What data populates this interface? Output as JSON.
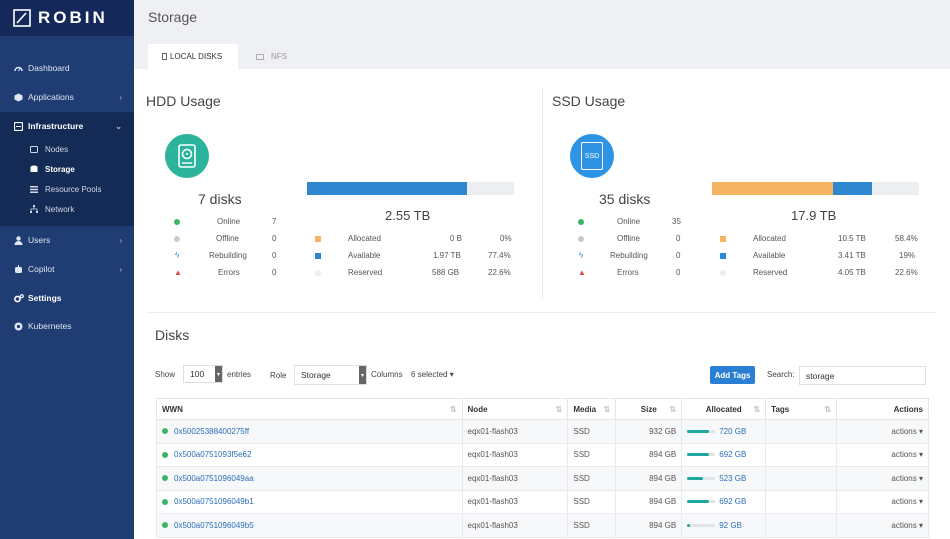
{
  "app": {
    "brand": "ROBIN"
  },
  "sidebar": {
    "items": [
      {
        "label": "Dashboard"
      },
      {
        "label": "Applications"
      },
      {
        "label": "Infrastructure"
      },
      {
        "label": "Users"
      },
      {
        "label": "Copilot"
      },
      {
        "label": "Settings"
      },
      {
        "label": "Kubernetes"
      }
    ],
    "infrastructure_sub": [
      {
        "label": "Nodes"
      },
      {
        "label": "Storage"
      },
      {
        "label": "Resource Pools"
      },
      {
        "label": "Network"
      }
    ]
  },
  "page": {
    "title": "Storage"
  },
  "tabs": [
    {
      "label": "LOCAL DISKS"
    },
    {
      "label": "NFS"
    }
  ],
  "hdd": {
    "title": "HDD Usage",
    "disks": "7 disks",
    "total": "2.55 TB",
    "status": [
      {
        "label": "Online",
        "value": "7"
      },
      {
        "label": "Offline",
        "value": "0"
      },
      {
        "label": "Rebuilding",
        "value": "0"
      },
      {
        "label": "Errors",
        "value": "0"
      }
    ],
    "usage": [
      {
        "label": "Allocated",
        "size": "0 B",
        "pct": "0%"
      },
      {
        "label": "Available",
        "size": "1.97 TB",
        "pct": "77.4%"
      },
      {
        "label": "Reserved",
        "size": "588 GB",
        "pct": "22.6%"
      }
    ],
    "bar": {
      "allocated": 0.0,
      "available": 77.4,
      "reserved": 22.6
    }
  },
  "ssd": {
    "title": "SSD Usage",
    "icon_text": "SSD",
    "disks": "35 disks",
    "total": "17.9 TB",
    "status": [
      {
        "label": "Online",
        "value": "35"
      },
      {
        "label": "Offline",
        "value": "0"
      },
      {
        "label": "Rebuilding",
        "value": "0"
      },
      {
        "label": "Errors",
        "value": "0"
      }
    ],
    "usage": [
      {
        "label": "Allocated",
        "size": "10.5 TB",
        "pct": "58.4%"
      },
      {
        "label": "Available",
        "size": "3.41 TB",
        "pct": "19%"
      },
      {
        "label": "Reserved",
        "size": "4.05 TB",
        "pct": "22.6%"
      }
    ],
    "bar": {
      "allocated": 58.4,
      "available": 19.0,
      "reserved": 22.6
    }
  },
  "disks": {
    "title": "Disks",
    "show_label": "Show",
    "show_value": "100",
    "entries_label": "entries",
    "role_label": "Role",
    "role_value": "Storage",
    "columns_label": "Columns",
    "columns_value": "6 selected",
    "add_tags": "Add Tags",
    "search_label": "Search:",
    "search_value": "storage",
    "headers": [
      "WWN",
      "Node",
      "Media",
      "Size",
      "Allocated",
      "Tags",
      "Actions"
    ],
    "rows": [
      {
        "wwn": "0x50025388400275ff",
        "node": "eqx01-flash03",
        "media": "SSD",
        "size": "932 GB",
        "allocated": "720 GB",
        "alloc_frac": 0.77,
        "actions": "actions"
      },
      {
        "wwn": "0x500a0751093f5e62",
        "node": "eqx01-flash03",
        "media": "SSD",
        "size": "894 GB",
        "allocated": "692 GB",
        "alloc_frac": 0.77,
        "actions": "actions"
      },
      {
        "wwn": "0x500a0751096049aa",
        "node": "eqx01-flash03",
        "media": "SSD",
        "size": "894 GB",
        "allocated": "523 GB",
        "alloc_frac": 0.58,
        "actions": "actions"
      },
      {
        "wwn": "0x500a0751096049b1",
        "node": "eqx01-flash03",
        "media": "SSD",
        "size": "894 GB",
        "allocated": "692 GB",
        "alloc_frac": 0.77,
        "actions": "actions"
      },
      {
        "wwn": "0x500a0751096049b5",
        "node": "eqx01-flash03",
        "media": "SSD",
        "size": "894 GB",
        "allocated": "92 GB",
        "alloc_frac": 0.1,
        "actions": "actions"
      }
    ]
  },
  "colors": {
    "allocated": "#f5b461",
    "available": "#2f87cf",
    "reserved": "#eceef1",
    "online": "#3cb465",
    "offline": "#c9cbcf",
    "rebuilding": "#2f87cf",
    "errors": "#e04848",
    "hdd_icon": "#2bb39b",
    "ssd_icon": "#2e95e6"
  }
}
